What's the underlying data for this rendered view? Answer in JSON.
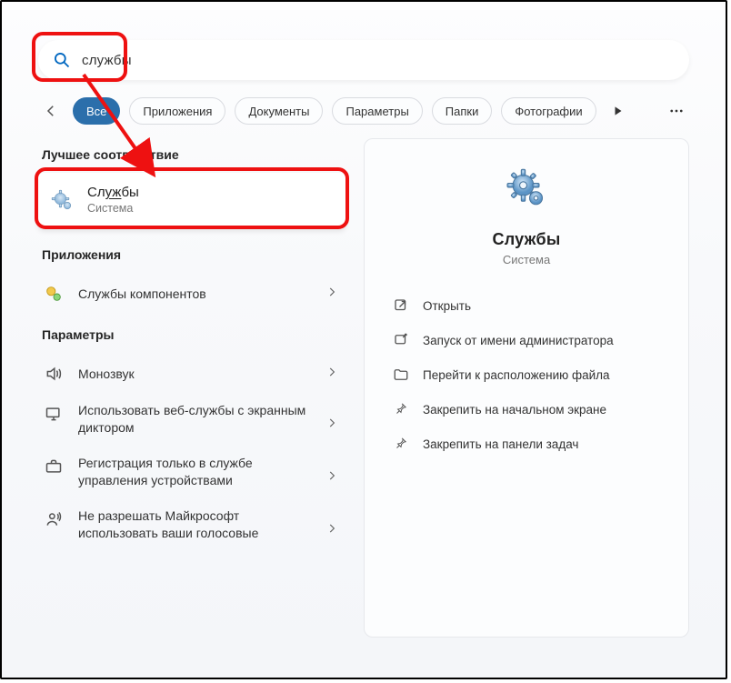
{
  "search": {
    "query": "службы"
  },
  "tabs": {
    "all": "Все",
    "apps": "Приложения",
    "docs": "Документы",
    "params": "Параметры",
    "folders": "Папки",
    "photos": "Фотографии"
  },
  "sections": {
    "best": "Лучшее соответствие",
    "apps": "Приложения",
    "params": "Параметры"
  },
  "best_match": {
    "title": "Службы",
    "subtitle": "Система"
  },
  "apps_list": [
    {
      "label": "Службы компонентов"
    }
  ],
  "params_list": [
    {
      "label": "Монозвук"
    },
    {
      "label": "Использовать веб-службы с экранным диктором"
    },
    {
      "label": "Регистрация только в службе управления устройствами"
    },
    {
      "label": "Не разрешать Майкрософт использовать ваши голосовые"
    }
  ],
  "detail": {
    "title": "Службы",
    "subtitle": "Система",
    "actions": [
      {
        "label": "Открыть"
      },
      {
        "label": "Запуск от имени администратора"
      },
      {
        "label": "Перейти к расположению файла"
      },
      {
        "label": "Закрепить на начальном экране"
      },
      {
        "label": "Закрепить на панели задач"
      }
    ]
  }
}
